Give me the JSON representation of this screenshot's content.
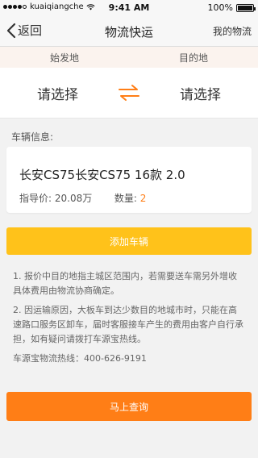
{
  "status_bar": {
    "carrier": "kuaiqiangche",
    "time": "9:41 AM",
    "battery": "100%"
  },
  "nav": {
    "back_label": "返回",
    "title": "物流快运",
    "right_label": "我的物流"
  },
  "route": {
    "origin_header": "始发地",
    "dest_header": "目的地",
    "origin_value": "请选择",
    "dest_value": "请选择"
  },
  "vehicle_section": {
    "label": "车辆信息:",
    "name": "长安CS75长安CS75 16款 2.0",
    "price_label": "指导价:",
    "price_value": "20.08万",
    "qty_label": "数量:",
    "qty_value": "2"
  },
  "add_button_label": "添加车辆",
  "notes": {
    "note1": "1. 报价中目的地指主城区范围内，若需要送车需另外增收具体费用由物流协商确定。",
    "note2": "2. 因运输原因，大板车到达少数目的地城市时，只能在高速路口服务区卸车，届时客服接车产生的费用由客户自行承担，如有疑问请拨打车源宝热线。",
    "hotline": "车源宝物流热线：400-626-9191"
  },
  "query_button_label": "马上查询",
  "colors": {
    "accent_orange": "#ff7e16",
    "add_yellow": "#ffc21a"
  }
}
